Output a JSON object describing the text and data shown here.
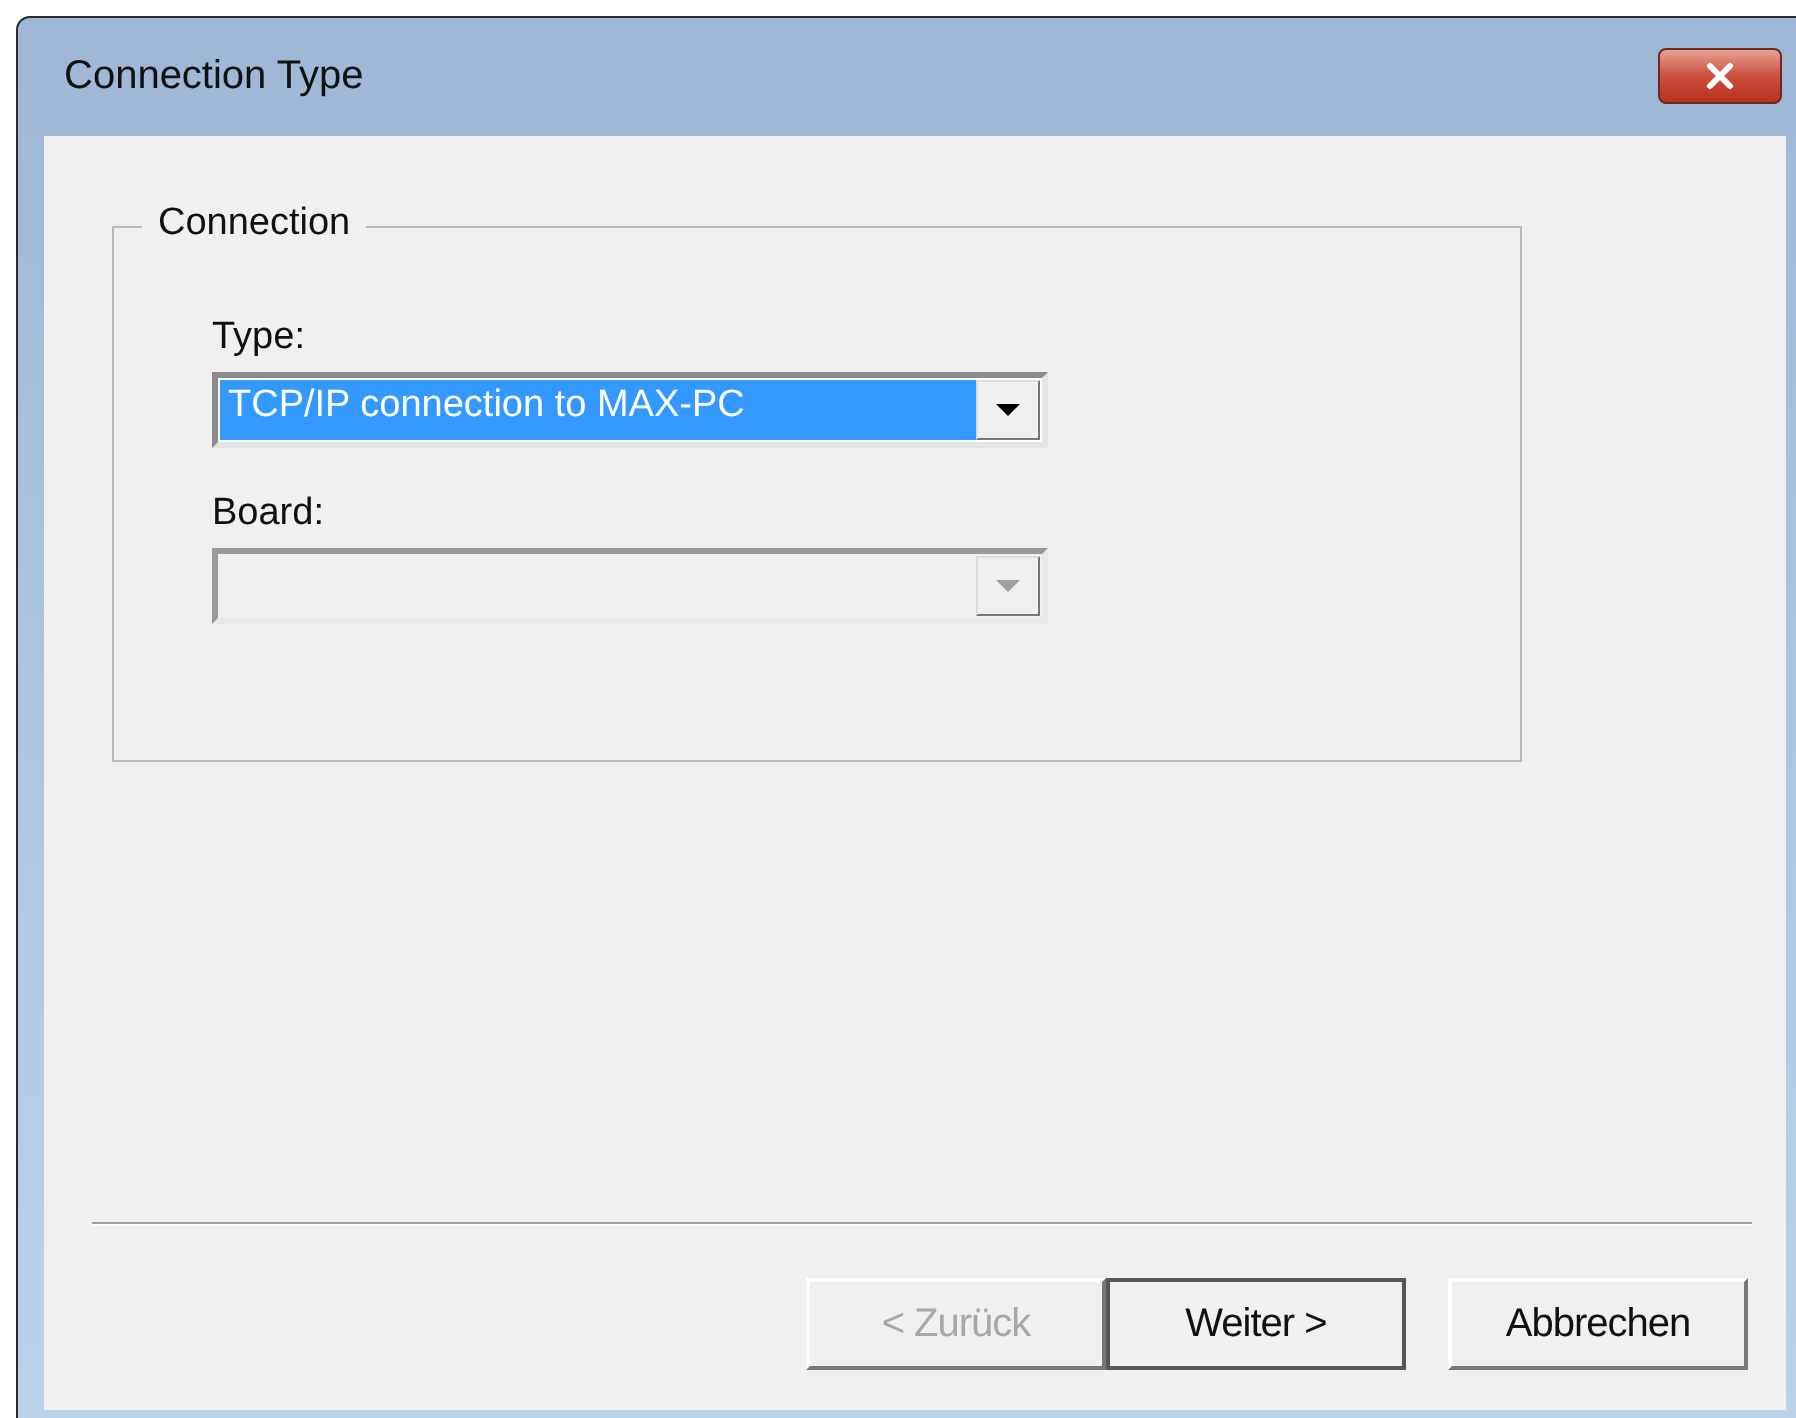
{
  "window": {
    "title": "Connection Type"
  },
  "group": {
    "title": "Connection"
  },
  "fields": [
    {
      "label": "Type:",
      "value": "TCP/IP connection to MAX-PC",
      "disabled": false,
      "selected": true
    },
    {
      "label": "Board:",
      "disabled": true,
      "selected": false
    }
  ],
  "buttons": [
    {
      "label": "< Zurück",
      "disabled": true,
      "default": false
    },
    {
      "label": "Weiter >",
      "disabled": false,
      "default": true
    },
    {
      "label": "Abbrechen",
      "disabled": false,
      "default": false
    }
  ]
}
